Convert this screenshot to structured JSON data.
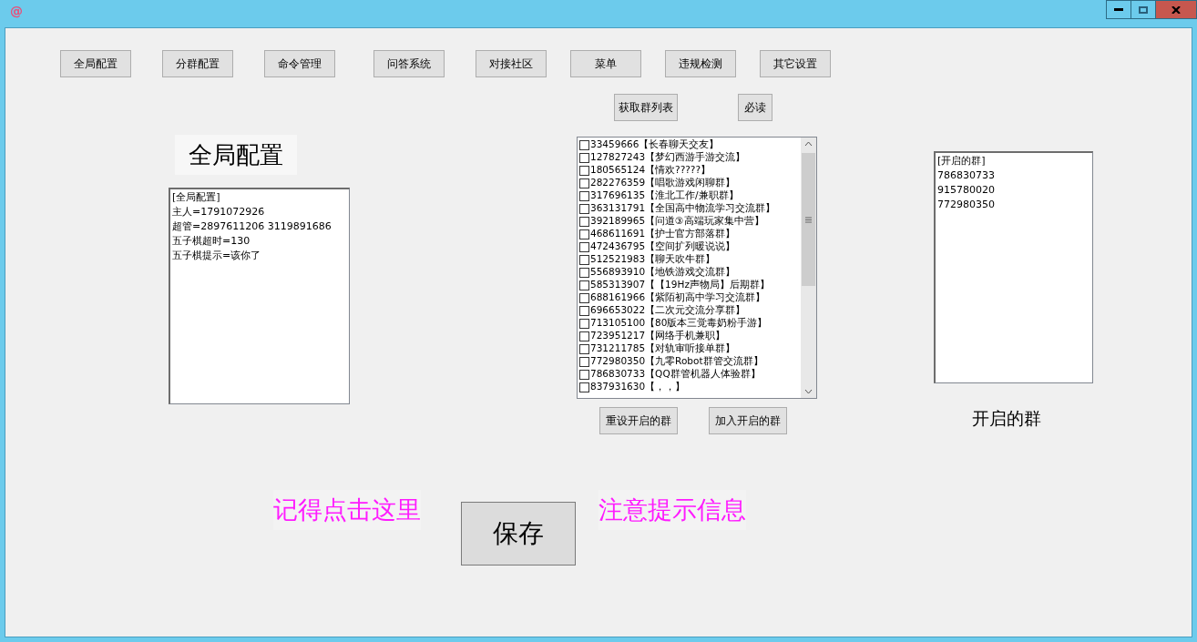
{
  "window": {
    "icon": "@"
  },
  "tabs": [
    {
      "label": "全局配置"
    },
    {
      "label": "分群配置"
    },
    {
      "label": "命令管理"
    },
    {
      "label": "问答系统"
    },
    {
      "label": "对接社区"
    },
    {
      "label": "菜单"
    },
    {
      "label": "违规检测"
    },
    {
      "label": "其它设置"
    }
  ],
  "buttons_top": [
    {
      "label": "获取群列表"
    },
    {
      "label": "必读"
    }
  ],
  "section_title": "全局配置",
  "config_text": [
    "[全局配置]",
    "主人=1791072926",
    "超管=2897611206 3119891686",
    "五子棋超时=130",
    "五子棋提示=该你了"
  ],
  "groups": [
    {
      "label": "33459666【长春聊天交友】",
      "checked": false
    },
    {
      "label": "127827243【梦幻西游手游交流】",
      "checked": false
    },
    {
      "label": "180565124【情欢?????】",
      "checked": false
    },
    {
      "label": "282276359【唱歌游戏闲聊群】",
      "checked": false
    },
    {
      "label": "317696135【淮北工作/兼职群】",
      "checked": false
    },
    {
      "label": "363131791【全国高中物流学习交流群】",
      "checked": false
    },
    {
      "label": "392189965【问道③高端玩家集中营】",
      "checked": false
    },
    {
      "label": "468611691【护士官方部落群】",
      "checked": false
    },
    {
      "label": "472436795【空间扩列暖说说】",
      "checked": false
    },
    {
      "label": "512521983【聊天吹牛群】",
      "checked": false
    },
    {
      "label": "556893910【地铁游戏交流群】",
      "checked": false
    },
    {
      "label": "585313907【【19Hz声物局】后期群】",
      "checked": false
    },
    {
      "label": "688161966【紫陌初高中学习交流群】",
      "checked": false
    },
    {
      "label": "696653022【二次元交流分享群】",
      "checked": false
    },
    {
      "label": "713105100【80版本三觉毒奶粉手游】",
      "checked": false
    },
    {
      "label": "723951217【网络手机兼职】",
      "checked": false
    },
    {
      "label": "731211785【对轨审听接单群】",
      "checked": false
    },
    {
      "label": "772980350【九零Robot群管交流群】",
      "checked": false
    },
    {
      "label": "786830733【QQ群管机器人体验群】",
      "checked": false
    },
    {
      "label": "837931630【，，】",
      "checked": false
    }
  ],
  "buttons_list": [
    {
      "label": "重设开启的群"
    },
    {
      "label": "加入开启的群"
    }
  ],
  "enabled_text": [
    "[开启的群]",
    "786830733",
    "915780020",
    "772980350"
  ],
  "enabled_caption": "开启的群",
  "hint_left": "记得点击这里",
  "save_button": "保存",
  "hint_right": "注意提示信息"
}
